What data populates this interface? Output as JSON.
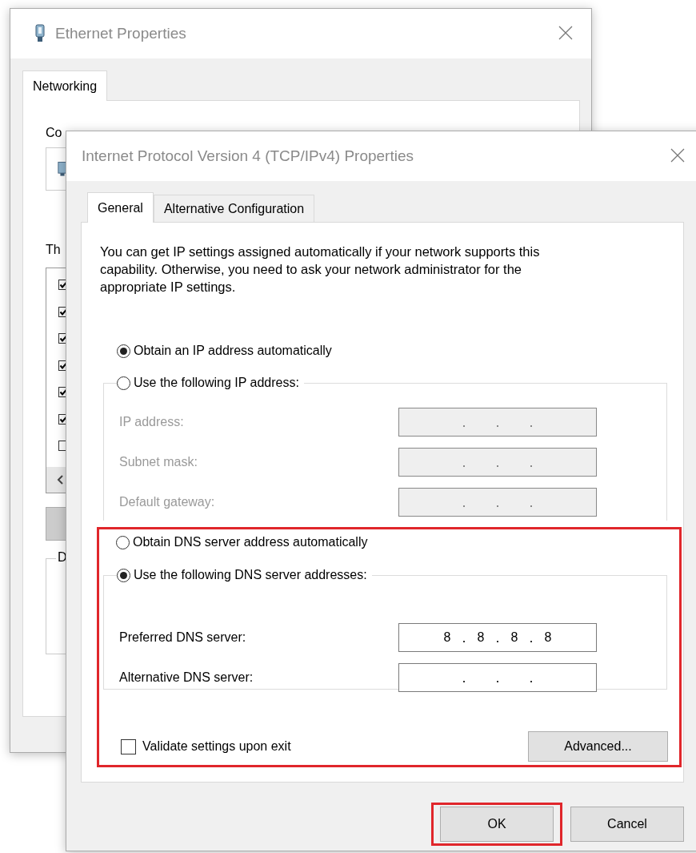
{
  "back_window": {
    "title": "Ethernet Properties",
    "tabs": [
      {
        "label": "Networking",
        "selected": true
      }
    ],
    "connect_label": "Co",
    "items_label": "Th",
    "items": [
      {
        "checked": true
      },
      {
        "checked": true
      },
      {
        "checked": true
      },
      {
        "checked": true
      },
      {
        "checked": true
      },
      {
        "checked": true
      },
      {
        "checked": false
      }
    ],
    "group_label": "D"
  },
  "window": {
    "title": "Internet Protocol Version 4 (TCP/IPv4) Properties"
  },
  "tabs": [
    {
      "label": "General",
      "selected": true
    },
    {
      "label": "Alternative Configuration",
      "selected": false
    }
  ],
  "intro": "You can get IP settings assigned automatically if your network supports this capability. Otherwise, you need to ask your network administrator for the appropriate IP settings.",
  "ip_options": [
    {
      "label": "Obtain an IP address automatically",
      "selected": true
    },
    {
      "label": "Use the following IP address:",
      "selected": false
    }
  ],
  "ip_fields": [
    {
      "label": "IP address:",
      "disabled": true
    },
    {
      "label": "Subnet mask:",
      "disabled": true
    },
    {
      "label": "Default gateway:",
      "disabled": true
    }
  ],
  "dns_section": {
    "highlighted": true,
    "options": [
      {
        "label": "Obtain DNS server address automatically",
        "selected": false
      },
      {
        "label": "Use the following DNS server addresses:",
        "selected": true
      }
    ],
    "fields": [
      {
        "label": "Preferred DNS server:",
        "disabled": false,
        "octets": [
          "8",
          "8",
          "8",
          "8"
        ]
      },
      {
        "label": "Alternative DNS server:",
        "disabled": false
      }
    ],
    "validate": {
      "label": "Validate settings upon exit",
      "checked": false
    },
    "advanced_button": "Advanced..."
  },
  "buttons": [
    {
      "label": "OK",
      "highlighted": true
    },
    {
      "label": "Cancel",
      "highlighted": false
    }
  ]
}
